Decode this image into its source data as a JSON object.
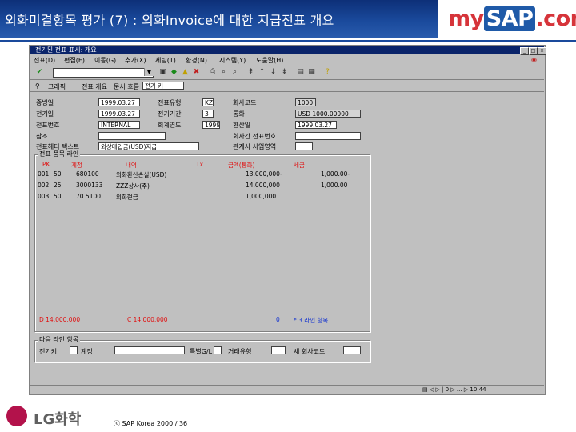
{
  "slide": {
    "title": "외화미결항목 평가 (7) : 외화Invoice에 대한 지급전표 개요",
    "logo": {
      "my": "my",
      "sap": "SAP",
      "com": ".com"
    },
    "footer_logo_text": "LG화학",
    "copyright": "ⓒ SAP Korea 2000 / 36"
  },
  "colors": {
    "header_band": "#1a4a9c",
    "logo_red": "#d6343a",
    "sap_grey": "#c0c0c0",
    "lg_red": "#b3124b",
    "amount_red": "#e01010",
    "total_blue": "#1030d0"
  },
  "window": {
    "title": "전기된 전표 표시: 개요",
    "menu": [
      "전표(D)",
      "편집(E)",
      "이동(G)",
      "추가(X)",
      "세팅(T)",
      "환경(N)",
      "시스템(Y)",
      "도움말(H)"
    ],
    "toolbar2": {
      "item1": "그래픽",
      "item2": "전표 개요",
      "item3": "문서 흐름",
      "field_value": "전기 키"
    },
    "status_text": "▤ ◁ ▷ | 0 ▷ ... ▷ 10:44"
  },
  "header_fields": {
    "left": [
      {
        "label": "증빙일",
        "value": "1999.03.27"
      },
      {
        "label": "전기일",
        "value": "1999.03.27"
      },
      {
        "label": "전표번호",
        "value": "INTERNAL"
      },
      {
        "label": "참조",
        "value": ""
      },
      {
        "label": "전표헤더 텍스트",
        "value": "외상매입금(USD)지급"
      }
    ],
    "middle": [
      {
        "label": "전표유형",
        "value": "KZ"
      },
      {
        "label": "전기기간",
        "value": "3"
      },
      {
        "label": "회계연도",
        "value": "1999"
      }
    ],
    "right": [
      {
        "label": "회사코드",
        "value": "1000"
      },
      {
        "label": "통화",
        "value": "USD  1000.00000"
      },
      {
        "label": "환산일",
        "value": "1999.03.27"
      },
      {
        "label": "회사간 전표번호",
        "value": ""
      },
      {
        "label": "관계사 사업영역",
        "value": ""
      }
    ]
  },
  "line_items": {
    "group_title": "전표 품목 라인",
    "headers": {
      "pk": "PK",
      "account": "계정",
      "description": "내역",
      "tx": "Tx",
      "amount": "금액(통화)",
      "tax": "세금"
    },
    "rows": [
      {
        "no": "001",
        "pk": "50",
        "account": "680100",
        "description": "외화환산손실(USD)",
        "amount": "13,000,000-",
        "tax": "1,000.00-"
      },
      {
        "no": "002",
        "pk": "25",
        "account": "3000133",
        "description": "ZZZ상사(주)",
        "amount": "14,000,000",
        "tax": "1,000.00"
      },
      {
        "no": "003",
        "pk": "50",
        "account": "70 5100",
        "description": "외화현금",
        "amount": "1,000,000",
        "tax": ""
      }
    ],
    "totals": {
      "debit": "D 14,000,000",
      "credit": "C 14,000,000",
      "zero": "0",
      "items": "* 3 라인 항목"
    }
  },
  "defaults": {
    "group_title": "다음 라인 항목",
    "key_label": "전기키",
    "account_label": "계정",
    "sgl_label": "특별G/L",
    "tx_label": "거래유형",
    "company_label": "새 회사코드"
  }
}
